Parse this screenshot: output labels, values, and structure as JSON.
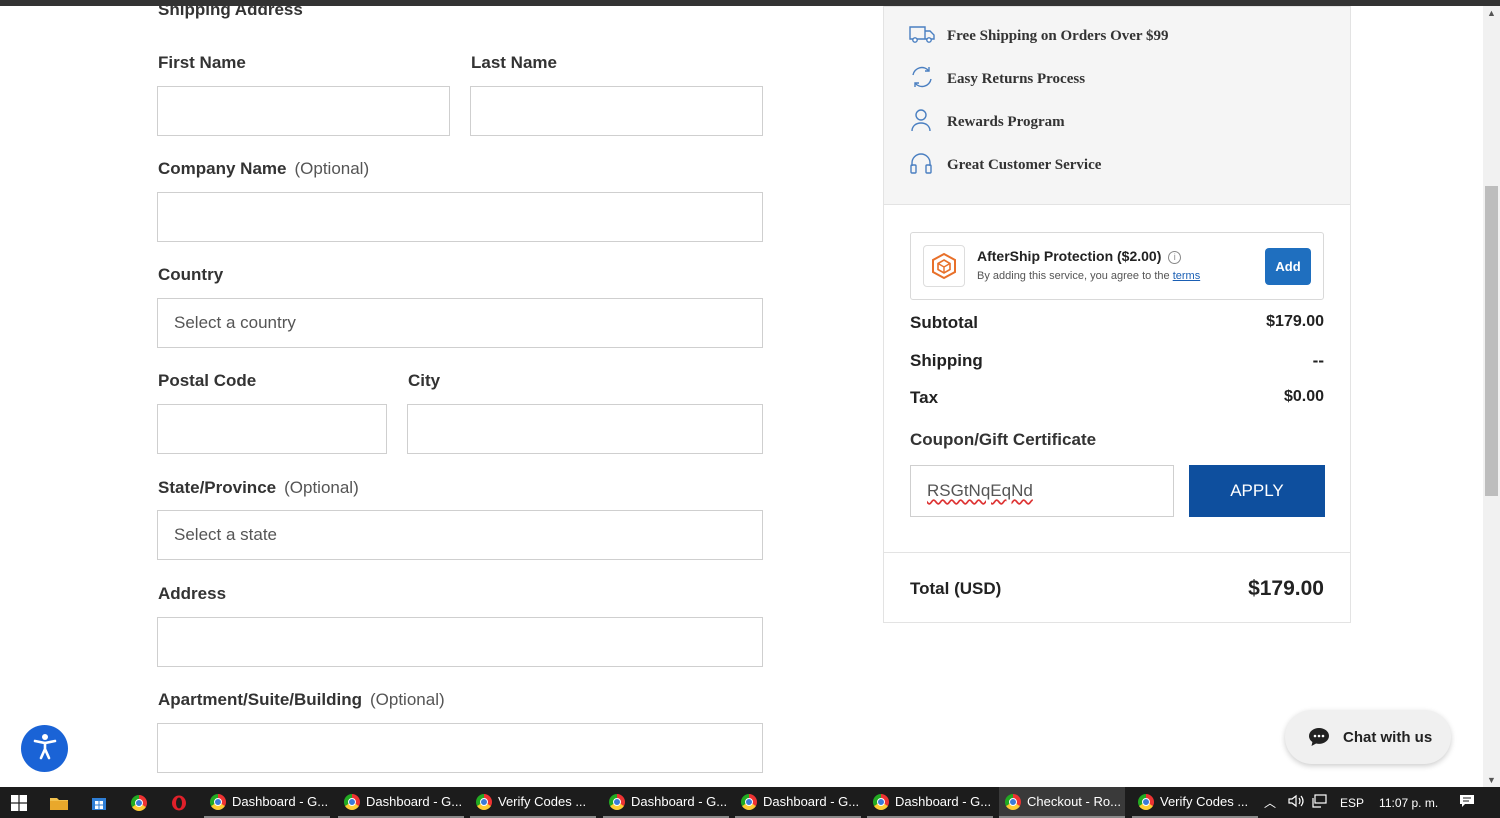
{
  "form": {
    "section_title": "Shipping Address",
    "first_name_label": "First Name",
    "last_name_label": "Last Name",
    "company_label": "Company Name",
    "optional": "(Optional)",
    "country_label": "Country",
    "country_placeholder": "Select a country",
    "postal_label": "Postal Code",
    "city_label": "City",
    "state_label": "State/Province",
    "state_placeholder": "Select a state",
    "address_label": "Address",
    "apt_label": "Apartment/Suite/Building"
  },
  "perks": [
    {
      "icon": "truck-icon",
      "label": "Free Shipping on Orders Over $99"
    },
    {
      "icon": "returns-icon",
      "label": "Easy Returns Process"
    },
    {
      "icon": "user-icon",
      "label": "Rewards Program"
    },
    {
      "icon": "headset-icon",
      "label": "Great Customer Service"
    }
  ],
  "protection": {
    "title": "AfterShip Protection ($2.00)",
    "subtitle": "By adding this service, you agree to the",
    "terms_link": "terms",
    "add_button": "Add"
  },
  "totals": {
    "subtotal_label": "Subtotal",
    "subtotal_value": "$179.00",
    "shipping_label": "Shipping",
    "shipping_value": "--",
    "tax_label": "Tax",
    "tax_value": "$0.00",
    "total_label": "Total (USD)",
    "total_value": "$179.00"
  },
  "coupon": {
    "label": "Coupon/Gift Certificate",
    "value": "RSGtNqEqNd",
    "apply_button": "APPLY"
  },
  "chat": {
    "label": "Chat with us"
  },
  "taskbar": {
    "apps": [
      {
        "label": "Dashboard - G..."
      },
      {
        "label": "Dashboard - G..."
      },
      {
        "label": "Verify Codes ..."
      },
      {
        "label": "Dashboard - G..."
      },
      {
        "label": "Dashboard - G..."
      },
      {
        "label": "Dashboard - G..."
      },
      {
        "label": "Checkout - Ro..."
      },
      {
        "label": "Verify Codes ..."
      }
    ],
    "language": "ESP",
    "time": "11:07 p. m."
  },
  "colors": {
    "accent": "#0e4f9e",
    "add_button": "#1f6fbf",
    "a11y": "#1a63d6"
  }
}
